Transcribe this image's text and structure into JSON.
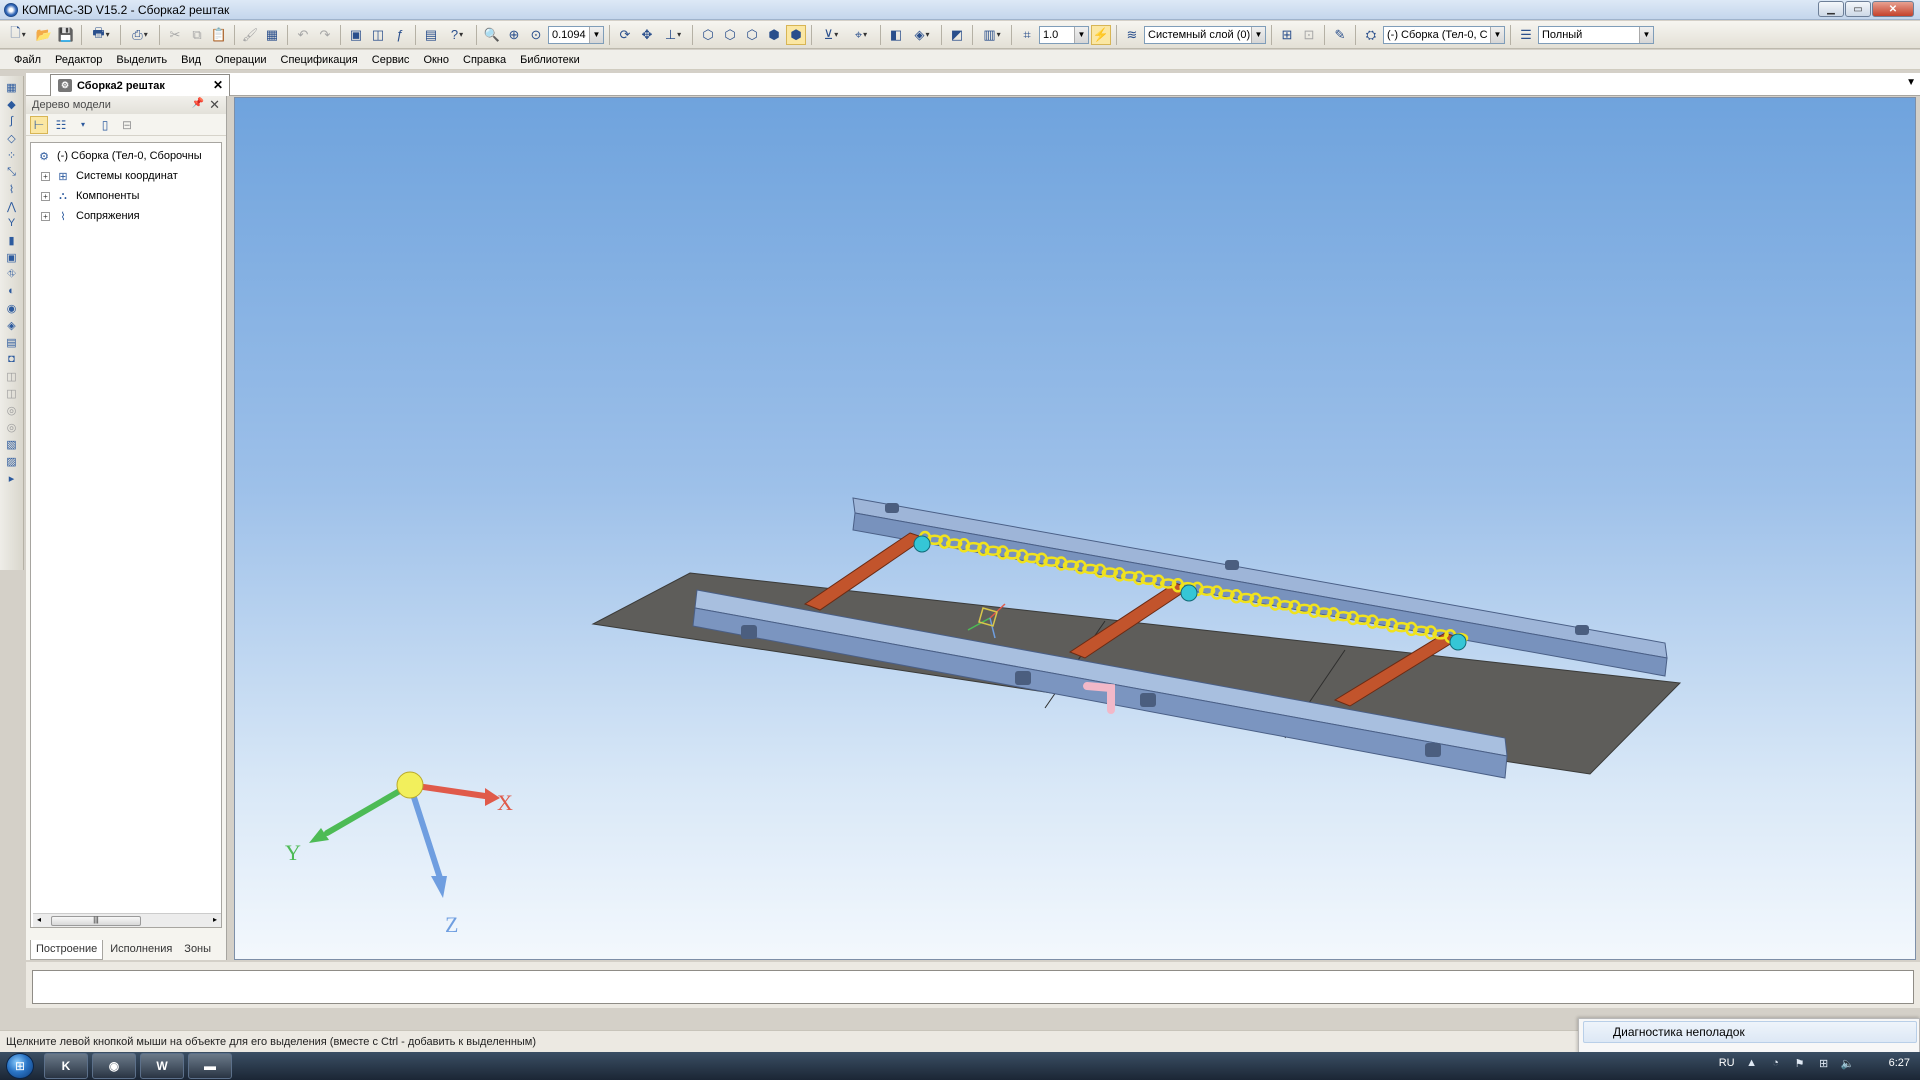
{
  "window": {
    "title": "КОМПАС-3D V15.2 - Сборка2 рештак",
    "minimize_icon": "minimize-icon",
    "maximize_icon": "maximize-icon",
    "close_icon": "close-icon"
  },
  "toolbar": {
    "zoom_value": "0.1094",
    "step_value": "1.0",
    "layer_value": "Системный слой (0)",
    "body_value": "(-) Сборка (Тел-0, С",
    "render_mode": "Полный"
  },
  "menu": {
    "items": [
      "Файл",
      "Редактор",
      "Выделить",
      "Вид",
      "Операции",
      "Спецификация",
      "Сервис",
      "Окно",
      "Справка",
      "Библиотеки"
    ]
  },
  "document_tab": {
    "label": "Сборка2 рештак"
  },
  "model_tree": {
    "header": "Дерево модели",
    "root_label": "(-) Сборка (Тел-0, Сборочны",
    "children": [
      "Системы координат",
      "Компоненты",
      "Сопряжения"
    ],
    "tabs": [
      "Построение",
      "Исполнения",
      "Зоны"
    ]
  },
  "axes": {
    "x_label": "X",
    "y_label": "Y",
    "z_label": "Z",
    "x_color": "#e05a4a",
    "y_color": "#4dbb55",
    "z_color": "#6f9ee0"
  },
  "colors": {
    "viewport_top": "#6fa3dd",
    "viewport_bottom": "#f3f8fd",
    "rail": "#93acd2",
    "pan": "#5e5d5a",
    "chain": "#f0e21e",
    "crossbar": "#c2542c",
    "bracket": "#35c6d6"
  },
  "status_text": "Щелкните левой кнопкой мыши на объекте для его выделения (вместе с Ctrl - добавить к выделенным)",
  "popup_item": "Диагностика неполадок",
  "taskbar": {
    "language": "RU",
    "time": "6:27",
    "apps": [
      "kompas-task",
      "firefox-task",
      "word-task",
      "explorer-task"
    ]
  }
}
